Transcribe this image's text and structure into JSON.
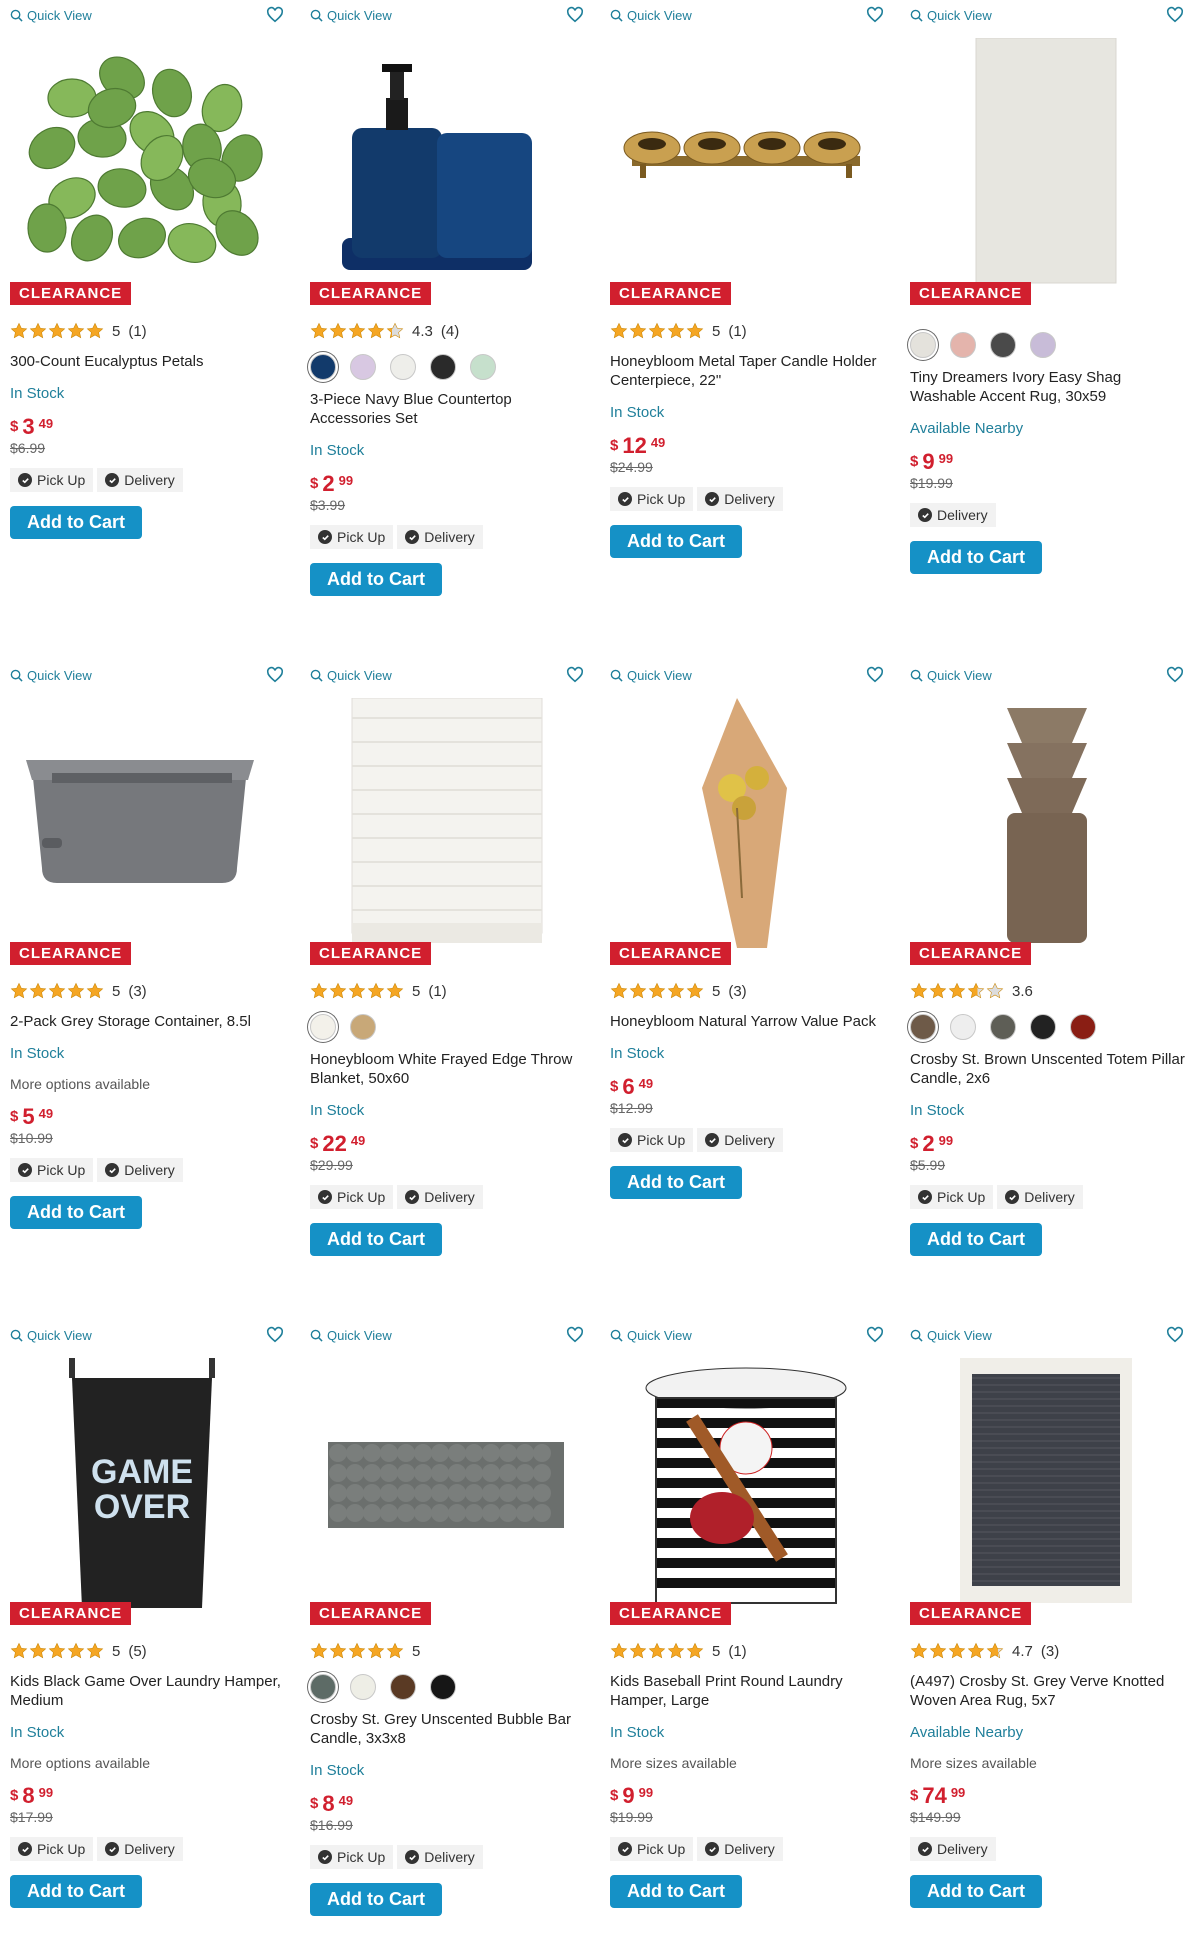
{
  "colors": {
    "accent": "#1591c6",
    "link": "#1f7f9a",
    "clearance": "#d11f2e",
    "star": "#f5a623"
  },
  "icons": {
    "quick_view": "search-icon",
    "wishlist": "heart-icon",
    "fulfillment": "check-circle-icon"
  },
  "labels": {
    "quick_view": "Quick View",
    "clearance": "CLEARANCE",
    "add_to_cart": "Add to Cart",
    "pick_up": "Pick Up",
    "delivery": "Delivery",
    "currency": "$"
  },
  "products": [
    {
      "title": "300-Count Eucalyptus Petals",
      "rating": 5,
      "rating_text": "5",
      "reviews": "(1)",
      "swatches": [],
      "stock": "In Stock",
      "more": "",
      "price_dollars": "3",
      "price_cents": "49",
      "was": "$6.99",
      "pickup": true,
      "delivery": true,
      "image": "eucalyptus"
    },
    {
      "title": "3-Piece Navy Blue Countertop Accessories Set",
      "rating": 4.3,
      "rating_text": "4.3",
      "reviews": "(4)",
      "swatches": [
        "#123a6b",
        "#d8c8e2",
        "#eeeeea",
        "#2a2a2a",
        "#c6e0cc"
      ],
      "stock": "In Stock",
      "more": "",
      "price_dollars": "2",
      "price_cents": "99",
      "was": "$3.99",
      "pickup": true,
      "delivery": true,
      "image": "countertop"
    },
    {
      "title": "Honeybloom Metal Taper Candle Holder Centerpiece, 22\"",
      "rating": 5,
      "rating_text": "5",
      "reviews": "(1)",
      "swatches": [],
      "stock": "In Stock",
      "more": "",
      "price_dollars": "12",
      "price_cents": "49",
      "was": "$24.99",
      "pickup": true,
      "delivery": true,
      "image": "candleholder"
    },
    {
      "title": "Tiny Dreamers Ivory Easy Shag Washable Accent Rug, 30x59",
      "rating": 0,
      "rating_text": "",
      "reviews": "",
      "swatches": [
        "#e4e2dc",
        "#e4b4ac",
        "#4a4a4a",
        "#c8bcd8"
      ],
      "stock": "Available Nearby",
      "more": "",
      "price_dollars": "9",
      "price_cents": "99",
      "was": "$19.99",
      "pickup": false,
      "delivery": true,
      "image": "rug-ivory"
    },
    {
      "title": "2-Pack Grey Storage Container, 8.5l",
      "rating": 5,
      "rating_text": "5",
      "reviews": "(3)",
      "swatches": [],
      "stock": "In Stock",
      "more": "More options available",
      "price_dollars": "5",
      "price_cents": "49",
      "was": "$10.99",
      "pickup": true,
      "delivery": true,
      "image": "storage"
    },
    {
      "title": "Honeybloom White Frayed Edge Throw Blanket, 50x60",
      "rating": 5,
      "rating_text": "5",
      "reviews": "(1)",
      "swatches": [
        "#f3f1ea",
        "#c8a878"
      ],
      "stock": "In Stock",
      "more": "",
      "price_dollars": "22",
      "price_cents": "49",
      "was": "$29.99",
      "pickup": true,
      "delivery": true,
      "image": "blanket"
    },
    {
      "title": "Honeybloom Natural Yarrow Value Pack",
      "rating": 5,
      "rating_text": "5",
      "reviews": "(3)",
      "swatches": [],
      "stock": "In Stock",
      "more": "",
      "price_dollars": "6",
      "price_cents": "49",
      "was": "$12.99",
      "pickup": true,
      "delivery": true,
      "image": "yarrow"
    },
    {
      "title": "Crosby St. Brown Unscented Totem Pillar Candle, 2x6",
      "rating": 3.6,
      "rating_text": "3.6",
      "reviews": "",
      "swatches": [
        "#6e5a48",
        "#eeeeee",
        "#5e5e56",
        "#222222",
        "#8a1e14"
      ],
      "stock": "In Stock",
      "more": "",
      "price_dollars": "2",
      "price_cents": "99",
      "was": "$5.99",
      "pickup": true,
      "delivery": true,
      "image": "totem"
    },
    {
      "title": "Kids Black Game Over Laundry Hamper, Medium",
      "rating": 5,
      "rating_text": "5",
      "reviews": "(5)",
      "swatches": [],
      "stock": "In Stock",
      "more": "More options available",
      "price_dollars": "8",
      "price_cents": "99",
      "was": "$17.99",
      "pickup": true,
      "delivery": true,
      "image": "hamper-black",
      "print": "GAME OVER"
    },
    {
      "title": "Crosby St. Grey Unscented Bubble Bar Candle, 3x3x8",
      "rating": 5,
      "rating_text": "5",
      "reviews": "",
      "swatches": [
        "#5d6b66",
        "#eeeee6",
        "#5a3a24",
        "#161616"
      ],
      "stock": "In Stock",
      "more": "",
      "price_dollars": "8",
      "price_cents": "49",
      "was": "$16.99",
      "pickup": true,
      "delivery": true,
      "image": "bubble"
    },
    {
      "title": "Kids Baseball Print Round Laundry Hamper, Large",
      "rating": 5,
      "rating_text": "5",
      "reviews": "(1)",
      "swatches": [],
      "stock": "In Stock",
      "more": "More sizes available",
      "price_dollars": "9",
      "price_cents": "99",
      "was": "$19.99",
      "pickup": true,
      "delivery": true,
      "image": "hamper-baseball"
    },
    {
      "title": "(A497) Crosby St. Grey Verve Knotted Woven Area Rug, 5x7",
      "rating": 4.7,
      "rating_text": "4.7",
      "reviews": "(3)",
      "swatches": [],
      "stock": "Available Nearby",
      "more": "More sizes available",
      "price_dollars": "74",
      "price_cents": "99",
      "was": "$149.99",
      "pickup": false,
      "delivery": true,
      "image": "rug-grey"
    }
  ]
}
